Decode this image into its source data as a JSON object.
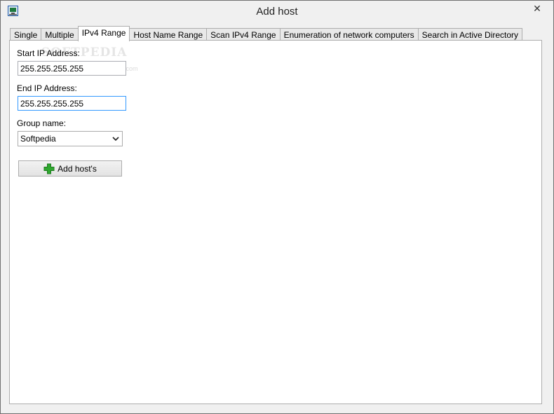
{
  "window": {
    "title": "Add host",
    "close_glyph": "✕",
    "app_icon": "network-app-icon"
  },
  "tabs": [
    {
      "label": "Single",
      "active": false
    },
    {
      "label": "Multiple",
      "active": false
    },
    {
      "label": "IPv4 Range",
      "active": true
    },
    {
      "label": "Host Name Range",
      "active": false
    },
    {
      "label": "Scan IPv4 Range",
      "active": false
    },
    {
      "label": "Enumeration of network computers",
      "active": false
    },
    {
      "label": "Search in Active Directory",
      "active": false
    }
  ],
  "form": {
    "start_ip_label": "Start IP Address:",
    "start_ip_value": "255.255.255.255",
    "end_ip_label": "End IP Address:",
    "end_ip_value": "255.255.255.255",
    "group_label": "Group name:",
    "group_value": "Softpedia",
    "add_button_label": "Add host's"
  },
  "watermark": {
    "text": "SOFTPEDIA",
    "url": "www.softpedia.com"
  },
  "colors": {
    "accent_focus": "#3399ff",
    "plus_icon": "#2fa82f"
  }
}
